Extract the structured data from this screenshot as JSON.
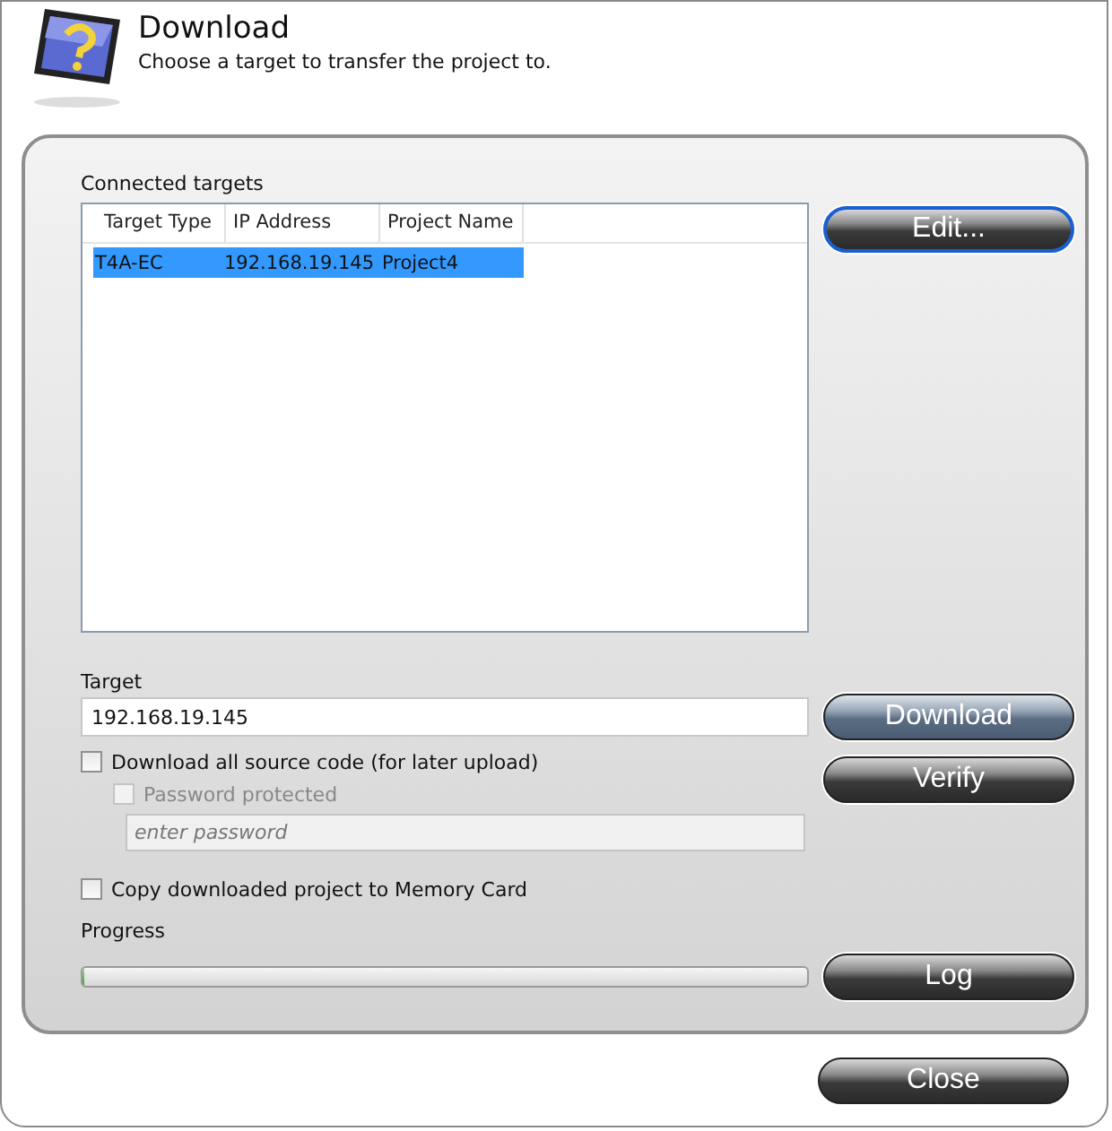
{
  "header": {
    "title": "Download",
    "subtitle": "Choose a target to transfer the project to."
  },
  "connected_targets": {
    "label": "Connected targets",
    "columns": [
      "Target Type",
      "IP Address",
      "Project Name"
    ],
    "rows": [
      {
        "cells": [
          "T4A-EC",
          "192.168.19.145",
          "Project4"
        ],
        "selected": true
      }
    ]
  },
  "target": {
    "label": "Target",
    "value": "192.168.19.145"
  },
  "download_source": {
    "label": "Download all source code (for later upload)",
    "checked": false,
    "disabled": false
  },
  "password_protected": {
    "label": "Password protected",
    "checked": false,
    "disabled": true
  },
  "password": {
    "placeholder": "enter password",
    "disabled": true
  },
  "copy_to_memory_card": {
    "label": "Copy downloaded project to Memory Card",
    "checked": false,
    "disabled": false
  },
  "progress": {
    "label": "Progress",
    "level": 0
  },
  "buttons": [
    {
      "label": "Edit...",
      "kind": "focused"
    },
    {
      "label": "Download",
      "kind": "default"
    },
    {
      "label": "Verify",
      "kind": "normal"
    },
    {
      "label": "Log",
      "kind": "normal"
    },
    {
      "label": "Close",
      "kind": "normal"
    }
  ]
}
